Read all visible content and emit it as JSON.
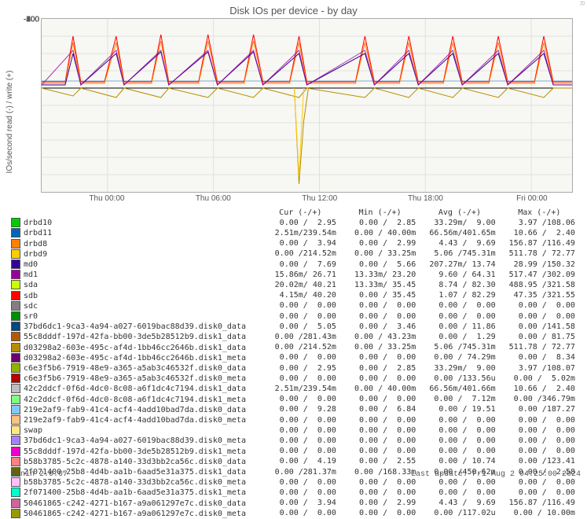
{
  "title": "Disk IOs per device - by day",
  "ylabel": "IOs/second read (-) / write (+)",
  "watermark": "RRDTOOL / TOBI OETIKER",
  "footer_left": "Munin 2.0.67",
  "footer_right": "Last update: Fri Aug  2 04:25:00 2024",
  "columns": {
    "cur": "Cur (-/+)",
    "min": "Min (-/+)",
    "avg": "Avg (-/+)",
    "max": "Max (-/+)"
  },
  "chart_data": {
    "type": "line",
    "title": "Disk IOs per device - by day",
    "xlabel": "",
    "ylabel": "IOs/second read (-) / write (+)",
    "ylim": [
      -600,
      400
    ],
    "yticks": [
      -600,
      -500,
      -400,
      -300,
      -200,
      -100,
      0,
      100,
      200,
      300,
      400
    ],
    "xticks": [
      "Thu 00:00",
      "Thu 06:00",
      "Thu 12:00",
      "Thu 18:00",
      "Fri 00:00"
    ],
    "note": "Periodic spikes roughly every ~2.5h: writes reach ~250-320 IOs/s, reads close to 0 except one large negative dip around Thu ~11:30 reaching ~-560. Baseline ~30-50 write.",
    "series_summary": "Visually overlapping multi-line: red/orange series dominate positive peaks (~300), blue/purple mid (~200), dark yellow one-off dip to ~-560."
  },
  "rows": [
    {
      "c": "#00cc00",
      "name": "drbd10",
      "cur": "0.00 /  2.95",
      "min": "0.00 /  2.85",
      "avg": "33.29m/  9.00",
      "max": "3.97 /108.06"
    },
    {
      "c": "#0066b3",
      "name": "drbd11",
      "cur": "2.51m/239.54m",
      "min": "0.00 / 40.00m",
      "avg": "66.56m/401.65m",
      "max": "10.66 /  2.40"
    },
    {
      "c": "#ff8000",
      "name": "drbd8",
      "cur": "0.00 /  3.94",
      "min": "0.00 /  2.99",
      "avg": "4.43 /  9.69",
      "max": "156.87 /116.49"
    },
    {
      "c": "#ffcc00",
      "name": "drbd9",
      "cur": "0.00 /214.52m",
      "min": "0.00 / 33.25m",
      "avg": "5.06 /745.31m",
      "max": "511.78 / 72.77"
    },
    {
      "c": "#330099",
      "name": "md0",
      "cur": "0.00 /  7.69",
      "min": "0.00 /  5.66",
      "avg": "207.27m/ 13.74",
      "max": "28.99 /150.32"
    },
    {
      "c": "#990099",
      "name": "md1",
      "cur": "15.86m/ 26.71",
      "min": "13.33m/ 23.20",
      "avg": "9.60 / 64.31",
      "max": "517.47 /302.09"
    },
    {
      "c": "#ccff00",
      "name": "sda",
      "cur": "20.02m/ 40.21",
      "min": "13.33m/ 35.45",
      "avg": "8.74 / 82.30",
      "max": "488.95 /321.58"
    },
    {
      "c": "#ff0000",
      "name": "sdb",
      "cur": "4.15m/ 40.20",
      "min": "0.00 / 35.45",
      "avg": "1.07 / 82.29",
      "max": "47.35 /321.55"
    },
    {
      "c": "#808080",
      "name": "sdc",
      "cur": "0.00 /  0.00",
      "min": "0.00 /  0.00",
      "avg": "0.00 /  0.00",
      "max": "0.00 /  0.00"
    },
    {
      "c": "#008f00",
      "name": "sr0",
      "cur": "0.00 /  0.00",
      "min": "0.00 /  0.00",
      "avg": "0.00 /  0.00",
      "max": "0.00 /  0.00"
    },
    {
      "c": "#00487d",
      "name": "37bd6dc1-9ca3-4a94-a027-6019bac88d39.disk0_data",
      "cur": "0.00 /  5.05",
      "min": "0.00 /  3.46",
      "avg": "0.00 / 11.86",
      "max": "0.00 /141.58"
    },
    {
      "c": "#b35a00",
      "name": "55c8dddf-197d-42fa-bb00-3de5b28512b9.disk1_data",
      "cur": "0.00 /281.43m",
      "min": "0.00 / 43.23m",
      "avg": "0.00 /  1.29",
      "max": "0.00 / 81.75"
    },
    {
      "c": "#b38f00",
      "name": "d03298a2-603e-495c-af4d-1bb46cc2646b.disk1_data",
      "cur": "0.00 /214.52m",
      "min": "0.00 / 33.25m",
      "avg": "5.06 /745.31m",
      "max": "511.78 / 72.77"
    },
    {
      "c": "#6b006b",
      "name": "d03298a2-603e-495c-af4d-1bb46cc2646b.disk1_meta",
      "cur": "0.00 /  0.00",
      "min": "0.00 /  0.00",
      "avg": "0.00 / 74.29m",
      "max": "0.00 /  8.34"
    },
    {
      "c": "#8fb300",
      "name": "c6e3f5b6-7919-48e9-a365-a5ab3c46532f.disk0_data",
      "cur": "0.00 /  2.95",
      "min": "0.00 /  2.85",
      "avg": "33.29m/  9.00",
      "max": "3.97 /108.07"
    },
    {
      "c": "#b30000",
      "name": "c6e3f5b6-7919-48e9-a365-a5ab3c46532f.disk0_meta",
      "cur": "0.00 /  0.00",
      "min": "0.00 /  0.00",
      "avg": "0.00 /133.56u",
      "max": "0.00 /  5.02m"
    },
    {
      "c": "#bebebe",
      "name": "42c2ddcf-0f6d-4dc0-8c08-a6f1dc4c7194.disk1_data",
      "cur": "2.51m/239.54m",
      "min": "0.00 / 40.00m",
      "avg": "66.56m/401.66m",
      "max": "10.66 /  2.40"
    },
    {
      "c": "#80ff80",
      "name": "42c2ddcf-0f6d-4dc0-8c08-a6f1dc4c7194.disk1_meta",
      "cur": "0.00 /  0.00",
      "min": "0.00 /  0.00",
      "avg": "0.00 /  7.12m",
      "max": "0.00 /346.79m"
    },
    {
      "c": "#80c9ff",
      "name": "219e2af9-fab9-41c4-acf4-4add10bad7da.disk0_data",
      "cur": "0.00 /  9.28",
      "min": "0.00 /  6.84",
      "avg": "0.00 / 19.51",
      "max": "0.00 /187.27"
    },
    {
      "c": "#ffc080",
      "name": "219e2af9-fab9-41c4-acf4-4add10bad7da.disk0_meta",
      "cur": "0.00 /  0.00",
      "min": "0.00 /  0.00",
      "avg": "0.00 /  0.00",
      "max": "0.00 /  0.00"
    },
    {
      "c": "#ffe680",
      "name": "swap",
      "cur": "0.00 /  0.00",
      "min": "0.00 /  0.00",
      "avg": "0.00 /  0.00",
      "max": "0.00 /  0.00"
    },
    {
      "c": "#aa80ff",
      "name": "37bd6dc1-9ca3-4a94-a027-6019bac88d39.disk0_meta",
      "cur": "0.00 /  0.00",
      "min": "0.00 /  0.00",
      "avg": "0.00 /  0.00",
      "max": "0.00 /  0.00"
    },
    {
      "c": "#ee00cc",
      "name": "55c8dddf-197d-42fa-bb00-3de5b28512b9.disk1_meta",
      "cur": "0.00 /  0.00",
      "min": "0.00 /  0.00",
      "avg": "0.00 /  0.00",
      "max": "0.00 /  0.00"
    },
    {
      "c": "#ff8080",
      "name": "b58b3785-5c2c-4878-a140-33d3bb2ca56c.disk0_data",
      "cur": "0.00 /  4.19",
      "min": "0.00 /  2.55",
      "avg": "0.00 / 10.74",
      "max": "0.00 /123.41"
    },
    {
      "c": "#666600",
      "name": "2f071400-25b8-4d4b-aa1b-6aad5e31a375.disk1_data",
      "cur": "0.00 /281.37m",
      "min": "0.00 /168.33m",
      "avg": "0.00 /450.62m",
      "max": "0.00 /  2.58"
    },
    {
      "c": "#ffbfff",
      "name": "b58b3785-5c2c-4878-a140-33d3bb2ca56c.disk0_meta",
      "cur": "0.00 /  0.00",
      "min": "0.00 /  0.00",
      "avg": "0.00 /  0.00",
      "max": "0.00 /  0.00"
    },
    {
      "c": "#00ffcc",
      "name": "2f071400-25b8-4d4b-aa1b-6aad5e31a375.disk1_meta",
      "cur": "0.00 /  0.00",
      "min": "0.00 /  0.00",
      "avg": "0.00 /  0.00",
      "max": "0.00 /  0.00"
    },
    {
      "c": "#cc6699",
      "name": "50461865-c242-4271-b167-a9a061297e7c.disk0_data",
      "cur": "0.00 /  3.94",
      "min": "0.00 /  2.99",
      "avg": "4.43 /  9.69",
      "max": "156.87 /116.49"
    },
    {
      "c": "#999900",
      "name": "50461865-c242-4271-b167-a9a061297e7c.disk0_meta",
      "cur": "0.00 /  0.00",
      "min": "0.00 /  0.00",
      "avg": "0.00 /117.02u",
      "max": "0.00 / 10.00m"
    }
  ]
}
